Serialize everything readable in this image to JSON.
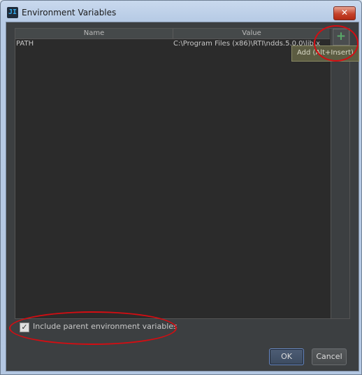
{
  "window": {
    "title": "Environment Variables",
    "app_icon_text": "JI",
    "close_symbol": "✕"
  },
  "table": {
    "columns": [
      "Name",
      "Value"
    ],
    "rows": [
      {
        "name": "PATH",
        "value": "C:\\Program Files (x86)\\RTI\\ndds.5.0.0\\lib\\x"
      }
    ]
  },
  "toolbar": {
    "add_symbol": "+",
    "add_tooltip": "Add (Alt+Insert)"
  },
  "options": {
    "include_parent_label": "Include parent environment variables",
    "include_parent_checked": true,
    "check_symbol": "✓"
  },
  "buttons": {
    "ok": "OK",
    "cancel": "Cancel"
  },
  "colors": {
    "annotation": "#d40d12",
    "add_icon": "#59a869"
  }
}
